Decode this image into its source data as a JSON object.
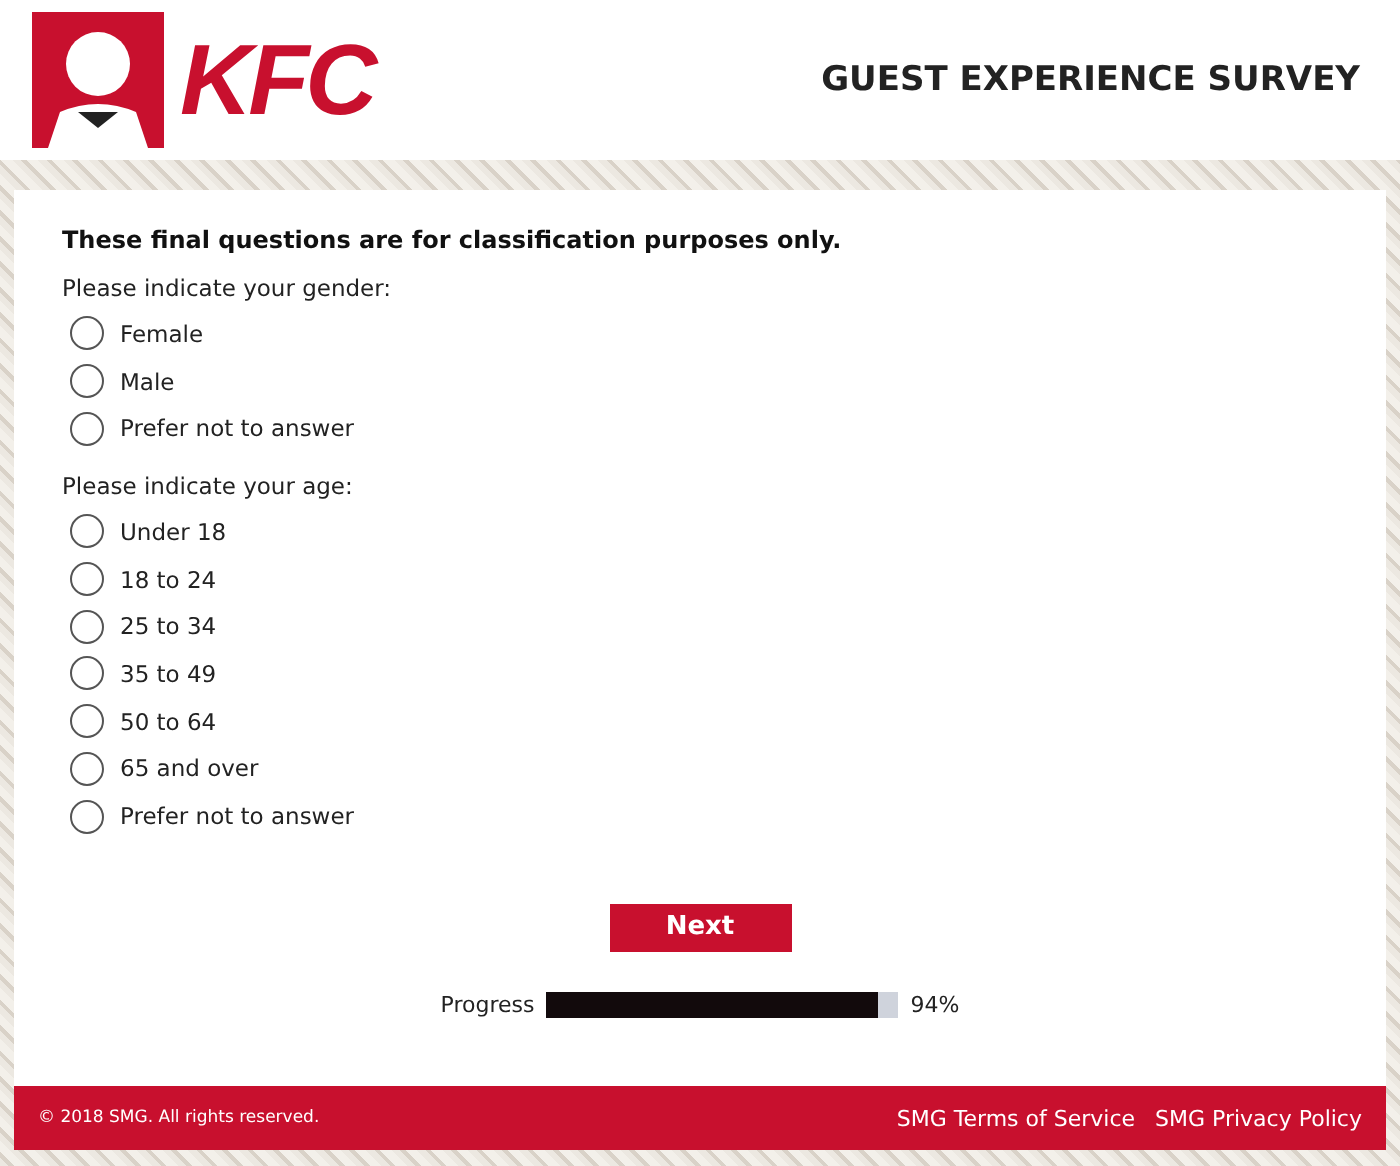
{
  "header": {
    "logo_text": "KFC",
    "title": "GUEST EXPERIENCE SURVEY"
  },
  "intro": "These final questions are for classification purposes only.",
  "questions": [
    {
      "prompt": "Please indicate your gender:",
      "options": [
        {
          "label": "Female",
          "selected": false
        },
        {
          "label": "Male",
          "selected": false
        },
        {
          "label": "Prefer not to answer",
          "selected": false
        }
      ]
    },
    {
      "prompt": "Please indicate your age:",
      "options": [
        {
          "label": "Under 18",
          "selected": false
        },
        {
          "label": "18 to 24",
          "selected": false
        },
        {
          "label": "25 to 34",
          "selected": false
        },
        {
          "label": "35 to 49",
          "selected": false
        },
        {
          "label": "50 to 64",
          "selected": false
        },
        {
          "label": "65 and over",
          "selected": false
        },
        {
          "label": "Prefer not to answer",
          "selected": false
        }
      ]
    }
  ],
  "next_button": "Next",
  "progress": {
    "label": "Progress",
    "level": 0.94,
    "reading": "94%"
  },
  "footer": {
    "copyright": "© 2018 SMG. All rights reserved.",
    "links": [
      "SMG Terms of Service",
      "SMG Privacy Policy"
    ]
  }
}
